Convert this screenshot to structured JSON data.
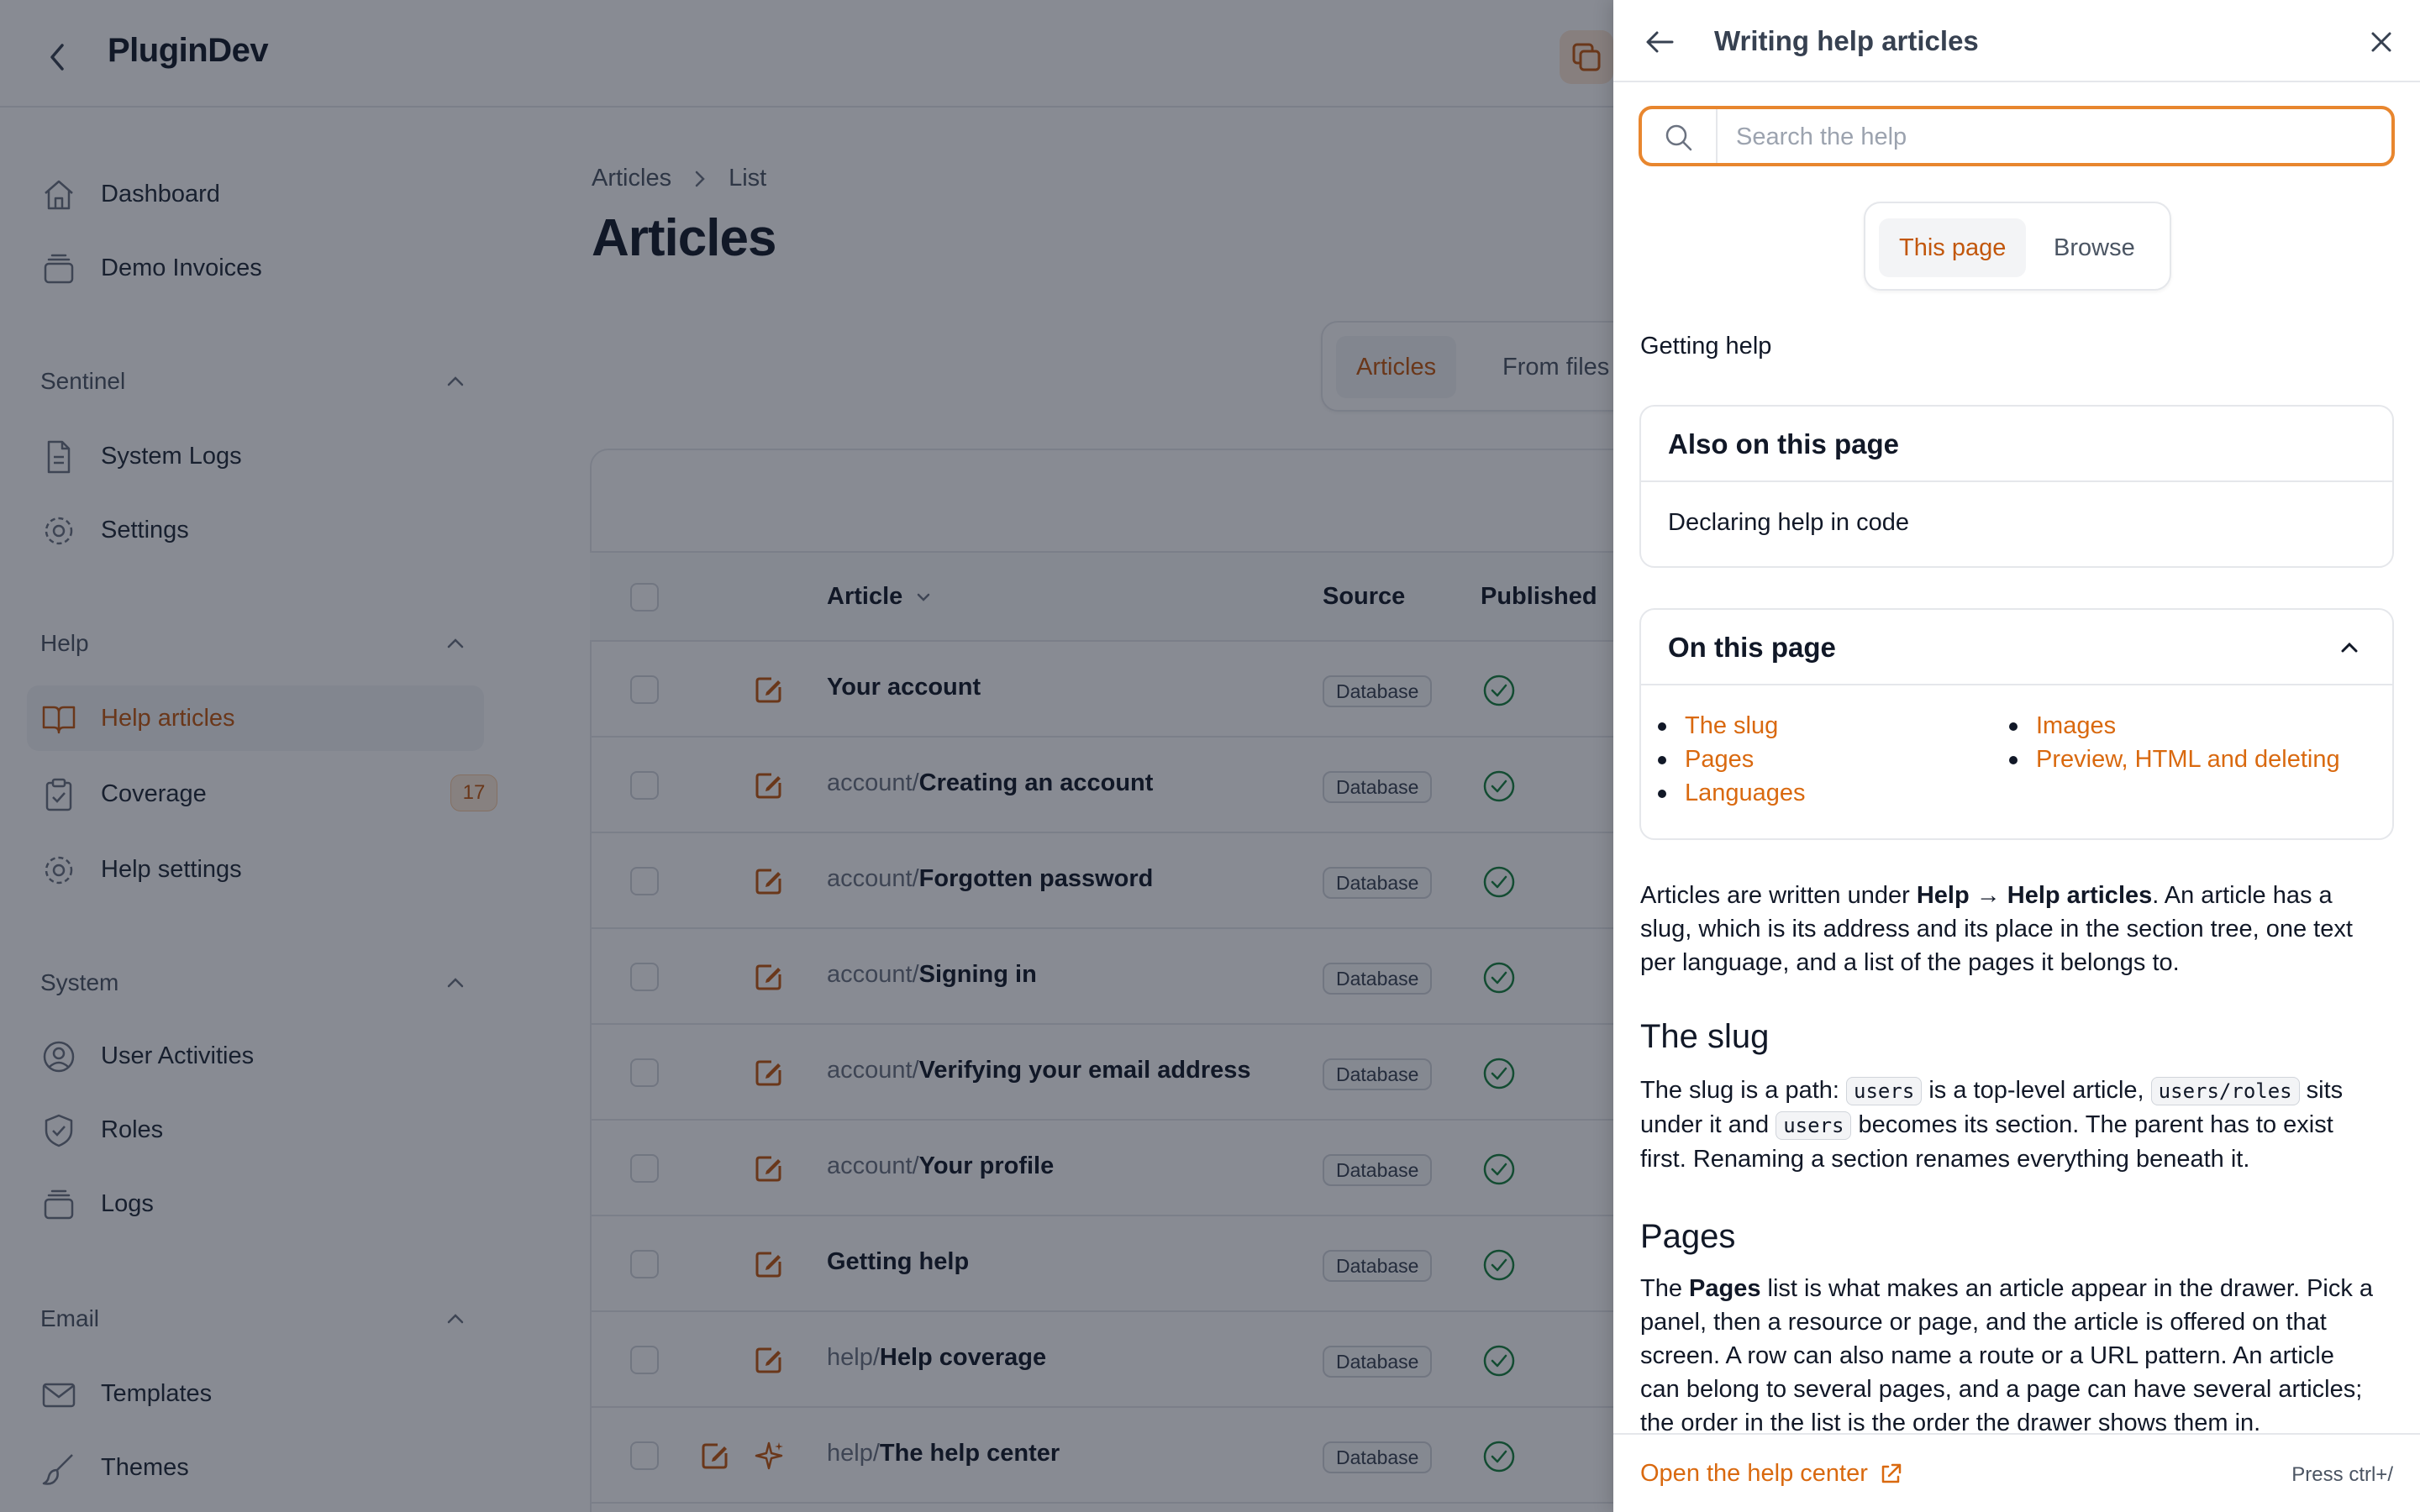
{
  "app": {
    "brand": "PluginDev"
  },
  "sidebar": {
    "items_top": [
      {
        "label": "Dashboard",
        "icon": "home-icon"
      },
      {
        "label": "Demo Invoices",
        "icon": "stack-icon"
      }
    ],
    "groups": {
      "sentinel": "Sentinel",
      "help": "Help",
      "system": "System",
      "email": "Email"
    },
    "sentinel_items": [
      {
        "label": "System Logs"
      },
      {
        "label": "Settings"
      }
    ],
    "help_items": [
      {
        "label": "Help articles"
      },
      {
        "label": "Coverage",
        "badge": "17"
      },
      {
        "label": "Help settings"
      }
    ],
    "system_items": [
      {
        "label": "User Activities"
      },
      {
        "label": "Roles"
      },
      {
        "label": "Logs"
      }
    ],
    "email_items": [
      {
        "label": "Templates"
      },
      {
        "label": "Themes"
      }
    ]
  },
  "main": {
    "breadcrumb": [
      "Articles",
      "List"
    ],
    "title": "Articles",
    "tabs": [
      {
        "label": "Articles",
        "active": true
      },
      {
        "label": "From files",
        "active": false
      }
    ],
    "columns": {
      "article": "Article",
      "source": "Source",
      "published": "Published"
    },
    "rows": [
      {
        "prefix": "",
        "name": "Your account",
        "source": "Database"
      },
      {
        "prefix": "account/",
        "name": "Creating an account",
        "source": "Database"
      },
      {
        "prefix": "account/",
        "name": "Forgotten password",
        "source": "Database"
      },
      {
        "prefix": "account/",
        "name": "Signing in",
        "source": "Database"
      },
      {
        "prefix": "account/",
        "name": "Verifying your email address",
        "source": "Database"
      },
      {
        "prefix": "account/",
        "name": "Your profile",
        "source": "Database"
      },
      {
        "prefix": "",
        "name": "Getting help",
        "source": "Database"
      },
      {
        "prefix": "help/",
        "name": "Help coverage",
        "source": "Database"
      },
      {
        "prefix": "help/",
        "name": "The help center",
        "source": "Database"
      }
    ]
  },
  "drawer": {
    "title": "Writing help articles",
    "search_placeholder": "Search the help",
    "tabs": [
      {
        "label": "This page",
        "active": true
      },
      {
        "label": "Browse",
        "active": false
      }
    ],
    "section_label": "Getting help",
    "also_on_page": {
      "title": "Also on this page",
      "item": "Declaring help in code"
    },
    "on_this_page": {
      "title": "On this page",
      "col1": [
        "The slug",
        "Pages",
        "Languages"
      ],
      "col2": [
        "Images",
        "Preview, HTML and deleting"
      ]
    },
    "intro": {
      "t1": "Articles are written under ",
      "b1": "Help",
      "arrow": " → ",
      "b2": "Help articles",
      "t2": ". An article has a slug, which is its address and its place in the section tree, one text per language, and a list of the pages it belongs to."
    },
    "slug": {
      "heading": "The slug",
      "t1": "The slug is a path: ",
      "c1": "users",
      "t2": " is a top-level article, ",
      "c2": "users/roles",
      "t3": " sits under it and ",
      "c3": "users",
      "t4": " becomes its section. The parent has to exist first. Renaming a section renames everything beneath it."
    },
    "pages": {
      "heading": "Pages",
      "t1": "The ",
      "b1": "Pages",
      "t2": " list is what makes an article appear in the drawer. Pick a panel, then a resource or page, and the article is offered on that screen. A row can also name a route or a URL pattern. An article can belong to several pages, and a page can have several articles; the order in the list is the order the drawer shows them in."
    },
    "footer": {
      "open_label": "Open the help center",
      "hint": "Press ctrl+/"
    }
  },
  "colors": {
    "accent": "#c2570c",
    "link": "#d9690f",
    "search_border": "#e8862e",
    "success": "#15803d"
  }
}
